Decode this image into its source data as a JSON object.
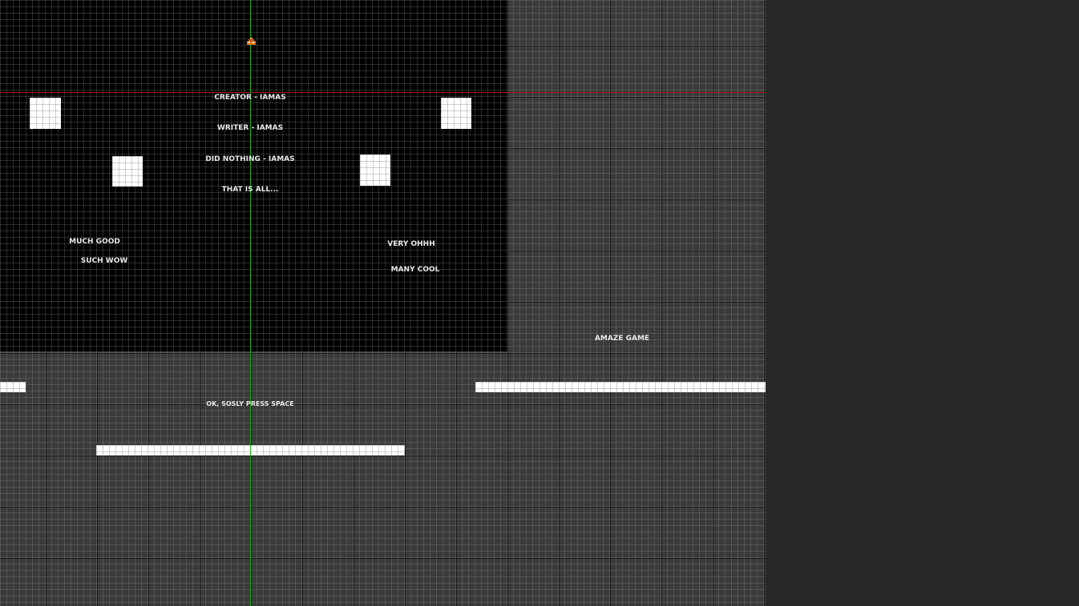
{
  "scene": {
    "credits": {
      "creator": "CREATOR - IAMAS",
      "writer": "WRITER - IAMAS",
      "did_nothing": "DID NOTHING - IAMAS",
      "that_is_all": "THAT IS ALL..."
    },
    "side_labels": {
      "much_good": "MUCH GOOD",
      "such_wow": "SUCH WOW",
      "very_ohhh": "VERY OHHH",
      "many_cool": "MANY COOL",
      "amaze_game": "AMAZE GAME"
    },
    "prompt": "OK, SOSLY PRESS SPACE",
    "player_icon": "player-sprite-icon"
  },
  "colors": {
    "background": "#282828",
    "grid": "#3a3a3a",
    "room": "#000000",
    "axis_x": "#a01818",
    "axis_y": "#1fae1f",
    "block": "#ffffff",
    "text": "#e8e8e8",
    "player": "#d9761a"
  }
}
